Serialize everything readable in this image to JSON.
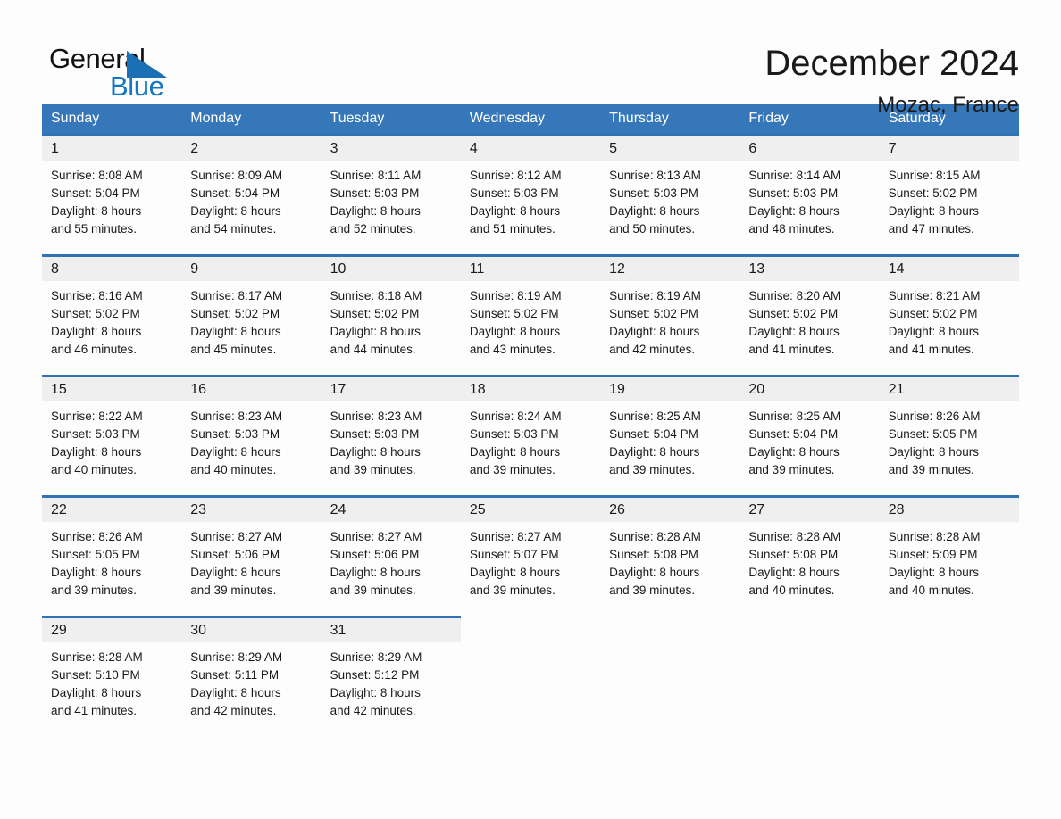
{
  "brand": {
    "word_one": "General",
    "word_two": "Blue",
    "triangle_color": "#1b6fb4",
    "blue_text_color": "#1375c6"
  },
  "header": {
    "month_title": "December 2024",
    "location": "Mozac, France"
  },
  "theme": {
    "header_blue": "#3577b8",
    "row_border_blue": "#2f72b3",
    "daynum_bg": "#efefef",
    "page_bg": "#fdfdfd"
  },
  "weekday_headers": [
    "Sunday",
    "Monday",
    "Tuesday",
    "Wednesday",
    "Thursday",
    "Friday",
    "Saturday"
  ],
  "weeks": [
    [
      {
        "day": "1",
        "sunrise": "Sunrise: 8:08 AM",
        "sunset": "Sunset: 5:04 PM",
        "daylight_line1": "Daylight: 8 hours",
        "daylight_line2": "and 55 minutes."
      },
      {
        "day": "2",
        "sunrise": "Sunrise: 8:09 AM",
        "sunset": "Sunset: 5:04 PM",
        "daylight_line1": "Daylight: 8 hours",
        "daylight_line2": "and 54 minutes."
      },
      {
        "day": "3",
        "sunrise": "Sunrise: 8:11 AM",
        "sunset": "Sunset: 5:03 PM",
        "daylight_line1": "Daylight: 8 hours",
        "daylight_line2": "and 52 minutes."
      },
      {
        "day": "4",
        "sunrise": "Sunrise: 8:12 AM",
        "sunset": "Sunset: 5:03 PM",
        "daylight_line1": "Daylight: 8 hours",
        "daylight_line2": "and 51 minutes."
      },
      {
        "day": "5",
        "sunrise": "Sunrise: 8:13 AM",
        "sunset": "Sunset: 5:03 PM",
        "daylight_line1": "Daylight: 8 hours",
        "daylight_line2": "and 50 minutes."
      },
      {
        "day": "6",
        "sunrise": "Sunrise: 8:14 AM",
        "sunset": "Sunset: 5:03 PM",
        "daylight_line1": "Daylight: 8 hours",
        "daylight_line2": "and 48 minutes."
      },
      {
        "day": "7",
        "sunrise": "Sunrise: 8:15 AM",
        "sunset": "Sunset: 5:02 PM",
        "daylight_line1": "Daylight: 8 hours",
        "daylight_line2": "and 47 minutes."
      }
    ],
    [
      {
        "day": "8",
        "sunrise": "Sunrise: 8:16 AM",
        "sunset": "Sunset: 5:02 PM",
        "daylight_line1": "Daylight: 8 hours",
        "daylight_line2": "and 46 minutes."
      },
      {
        "day": "9",
        "sunrise": "Sunrise: 8:17 AM",
        "sunset": "Sunset: 5:02 PM",
        "daylight_line1": "Daylight: 8 hours",
        "daylight_line2": "and 45 minutes."
      },
      {
        "day": "10",
        "sunrise": "Sunrise: 8:18 AM",
        "sunset": "Sunset: 5:02 PM",
        "daylight_line1": "Daylight: 8 hours",
        "daylight_line2": "and 44 minutes."
      },
      {
        "day": "11",
        "sunrise": "Sunrise: 8:19 AM",
        "sunset": "Sunset: 5:02 PM",
        "daylight_line1": "Daylight: 8 hours",
        "daylight_line2": "and 43 minutes."
      },
      {
        "day": "12",
        "sunrise": "Sunrise: 8:19 AM",
        "sunset": "Sunset: 5:02 PM",
        "daylight_line1": "Daylight: 8 hours",
        "daylight_line2": "and 42 minutes."
      },
      {
        "day": "13",
        "sunrise": "Sunrise: 8:20 AM",
        "sunset": "Sunset: 5:02 PM",
        "daylight_line1": "Daylight: 8 hours",
        "daylight_line2": "and 41 minutes."
      },
      {
        "day": "14",
        "sunrise": "Sunrise: 8:21 AM",
        "sunset": "Sunset: 5:02 PM",
        "daylight_line1": "Daylight: 8 hours",
        "daylight_line2": "and 41 minutes."
      }
    ],
    [
      {
        "day": "15",
        "sunrise": "Sunrise: 8:22 AM",
        "sunset": "Sunset: 5:03 PM",
        "daylight_line1": "Daylight: 8 hours",
        "daylight_line2": "and 40 minutes."
      },
      {
        "day": "16",
        "sunrise": "Sunrise: 8:23 AM",
        "sunset": "Sunset: 5:03 PM",
        "daylight_line1": "Daylight: 8 hours",
        "daylight_line2": "and 40 minutes."
      },
      {
        "day": "17",
        "sunrise": "Sunrise: 8:23 AM",
        "sunset": "Sunset: 5:03 PM",
        "daylight_line1": "Daylight: 8 hours",
        "daylight_line2": "and 39 minutes."
      },
      {
        "day": "18",
        "sunrise": "Sunrise: 8:24 AM",
        "sunset": "Sunset: 5:03 PM",
        "daylight_line1": "Daylight: 8 hours",
        "daylight_line2": "and 39 minutes."
      },
      {
        "day": "19",
        "sunrise": "Sunrise: 8:25 AM",
        "sunset": "Sunset: 5:04 PM",
        "daylight_line1": "Daylight: 8 hours",
        "daylight_line2": "and 39 minutes."
      },
      {
        "day": "20",
        "sunrise": "Sunrise: 8:25 AM",
        "sunset": "Sunset: 5:04 PM",
        "daylight_line1": "Daylight: 8 hours",
        "daylight_line2": "and 39 minutes."
      },
      {
        "day": "21",
        "sunrise": "Sunrise: 8:26 AM",
        "sunset": "Sunset: 5:05 PM",
        "daylight_line1": "Daylight: 8 hours",
        "daylight_line2": "and 39 minutes."
      }
    ],
    [
      {
        "day": "22",
        "sunrise": "Sunrise: 8:26 AM",
        "sunset": "Sunset: 5:05 PM",
        "daylight_line1": "Daylight: 8 hours",
        "daylight_line2": "and 39 minutes."
      },
      {
        "day": "23",
        "sunrise": "Sunrise: 8:27 AM",
        "sunset": "Sunset: 5:06 PM",
        "daylight_line1": "Daylight: 8 hours",
        "daylight_line2": "and 39 minutes."
      },
      {
        "day": "24",
        "sunrise": "Sunrise: 8:27 AM",
        "sunset": "Sunset: 5:06 PM",
        "daylight_line1": "Daylight: 8 hours",
        "daylight_line2": "and 39 minutes."
      },
      {
        "day": "25",
        "sunrise": "Sunrise: 8:27 AM",
        "sunset": "Sunset: 5:07 PM",
        "daylight_line1": "Daylight: 8 hours",
        "daylight_line2": "and 39 minutes."
      },
      {
        "day": "26",
        "sunrise": "Sunrise: 8:28 AM",
        "sunset": "Sunset: 5:08 PM",
        "daylight_line1": "Daylight: 8 hours",
        "daylight_line2": "and 39 minutes."
      },
      {
        "day": "27",
        "sunrise": "Sunrise: 8:28 AM",
        "sunset": "Sunset: 5:08 PM",
        "daylight_line1": "Daylight: 8 hours",
        "daylight_line2": "and 40 minutes."
      },
      {
        "day": "28",
        "sunrise": "Sunrise: 8:28 AM",
        "sunset": "Sunset: 5:09 PM",
        "daylight_line1": "Daylight: 8 hours",
        "daylight_line2": "and 40 minutes."
      }
    ],
    [
      {
        "day": "29",
        "sunrise": "Sunrise: 8:28 AM",
        "sunset": "Sunset: 5:10 PM",
        "daylight_line1": "Daylight: 8 hours",
        "daylight_line2": "and 41 minutes."
      },
      {
        "day": "30",
        "sunrise": "Sunrise: 8:29 AM",
        "sunset": "Sunset: 5:11 PM",
        "daylight_line1": "Daylight: 8 hours",
        "daylight_line2": "and 42 minutes."
      },
      {
        "day": "31",
        "sunrise": "Sunrise: 8:29 AM",
        "sunset": "Sunset: 5:12 PM",
        "daylight_line1": "Daylight: 8 hours",
        "daylight_line2": "and 42 minutes."
      },
      null,
      null,
      null,
      null
    ]
  ]
}
